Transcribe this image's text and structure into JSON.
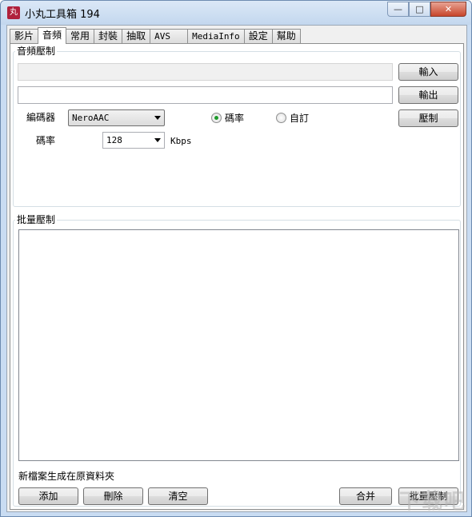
{
  "window": {
    "title": "小丸工具箱 194",
    "icon": "app-logo-icon",
    "icon_glyph": "丸",
    "controls": {
      "minimize": "—",
      "maximize": "□",
      "close": "✕"
    }
  },
  "tabs": [
    {
      "label": "影片"
    },
    {
      "label": "音頻",
      "active": true
    },
    {
      "label": "常用"
    },
    {
      "label": "封裝"
    },
    {
      "label": "抽取"
    },
    {
      "label": "AVS"
    },
    {
      "label": "MediaInfo"
    },
    {
      "label": "設定"
    },
    {
      "label": "幫助"
    }
  ],
  "audio_compress": {
    "group_label": "音頻壓制",
    "input_path": "",
    "output_path": "",
    "input_button": "輸入",
    "output_button": "輸出",
    "compress_button": "壓制",
    "encoder_label": "編碼器",
    "encoder_value": "NeroAAC",
    "rate_mode_bitrate": "碼率",
    "rate_mode_custom": "自訂",
    "bitrate_label": "碼率",
    "bitrate_value": "128",
    "bitrate_unit": "Kbps"
  },
  "batch": {
    "group_label": "批量壓制",
    "items": [],
    "note": "新檔案生成在原資料夾",
    "add_button": "添加",
    "delete_button": "刪除",
    "clear_button": "清空",
    "merge_button": "合并",
    "batch_button": "批量壓制"
  },
  "watermark": "下载吧"
}
